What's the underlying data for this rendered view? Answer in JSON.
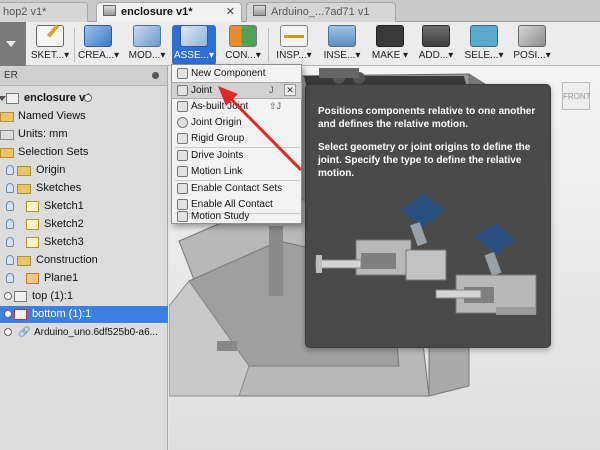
{
  "tabs": [
    {
      "label": "hop2 v1*"
    },
    {
      "label": "enclosure v1*",
      "close": "✕"
    },
    {
      "label": "Arduino_...7ad71 v1"
    }
  ],
  "toolbar": {
    "items": [
      {
        "label": "SKET...▾"
      },
      {
        "label": "CREA...▾"
      },
      {
        "label": "MOD...▾"
      },
      {
        "label": "ASSE...▾"
      },
      {
        "label": "CON...▾"
      },
      {
        "label": "INSP...▾"
      },
      {
        "label": "INSE...▾"
      },
      {
        "label": "MAKE ▾"
      },
      {
        "label": "ADD...▾"
      },
      {
        "label": "SELE...▾"
      },
      {
        "label": "POSI...▾"
      }
    ]
  },
  "browser": {
    "header": "ER",
    "items": [
      {
        "label": "enclosure v1"
      },
      {
        "label": "Named Views"
      },
      {
        "label": "Units: mm"
      },
      {
        "label": "Selection Sets"
      },
      {
        "label": "Origin"
      },
      {
        "label": "Sketches"
      },
      {
        "label": "Sketch1"
      },
      {
        "label": "Sketch2"
      },
      {
        "label": "Sketch3"
      },
      {
        "label": "Construction"
      },
      {
        "label": "Plane1"
      },
      {
        "label": "top (1):1"
      },
      {
        "label": "bottom (1):1"
      },
      {
        "label": "Arduino_uno.6df525b0-a6..."
      }
    ]
  },
  "assemble_menu": {
    "items": [
      {
        "label": "New Component",
        "shortcut": ""
      },
      {
        "label": "Joint",
        "shortcut": "J"
      },
      {
        "label": "As-built Joint",
        "shortcut": "⇧J"
      },
      {
        "label": "Joint Origin",
        "shortcut": ""
      },
      {
        "label": "Rigid Group",
        "shortcut": ""
      },
      {
        "label": "Drive Joints",
        "shortcut": ""
      },
      {
        "label": "Motion Link",
        "shortcut": ""
      },
      {
        "label": "Enable Contact Sets",
        "shortcut": ""
      },
      {
        "label": "Enable All Contact",
        "shortcut": ""
      },
      {
        "label": "Motion Study",
        "shortcut": ""
      }
    ],
    "close": "✕"
  },
  "tooltip": {
    "line1": "Positions components relative to one another and defines the relative motion.",
    "line2": "Select geometry or joint origins to define the joint. Specify the type to define the relative motion."
  },
  "viewcube": {
    "label": "FRONT"
  },
  "colors": {
    "accent": "#2d6fd6",
    "selection": "#3d7fe0",
    "arrow": "#e32626",
    "tooltip_bg": "#4a4a4a"
  }
}
